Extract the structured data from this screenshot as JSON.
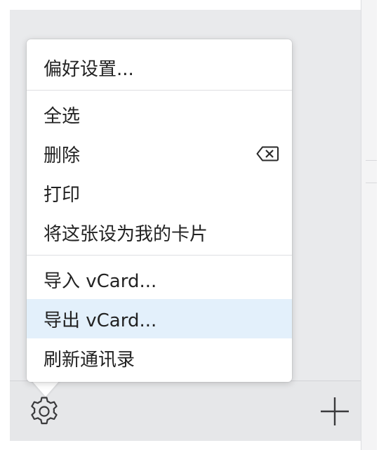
{
  "menu": {
    "sections": [
      {
        "items": [
          {
            "id": "preferences",
            "label": "偏好设置..."
          }
        ]
      },
      {
        "items": [
          {
            "id": "select-all",
            "label": "全选"
          },
          {
            "id": "delete",
            "label": "删除",
            "shortcut_icon": "delete-key-icon"
          },
          {
            "id": "print",
            "label": "打印"
          },
          {
            "id": "make-my-card",
            "label": "将这张设为我的卡片"
          }
        ]
      },
      {
        "items": [
          {
            "id": "import-vcard",
            "label": "导入 vCard..."
          },
          {
            "id": "export-vcard",
            "label": "导出 vCard...",
            "highlighted": true
          },
          {
            "id": "refresh-contacts",
            "label": "刷新通讯录"
          }
        ]
      }
    ]
  },
  "toolbar": {
    "left_icon": "gear-icon",
    "right_icon": "plus-icon"
  },
  "colors": {
    "menu_background": "#ffffff",
    "highlight": "#e3f0fb",
    "text": "#222222",
    "separator": "#dedfe2",
    "toolbar_background": "#e6e7e9",
    "window_background": "#e9eaec"
  }
}
